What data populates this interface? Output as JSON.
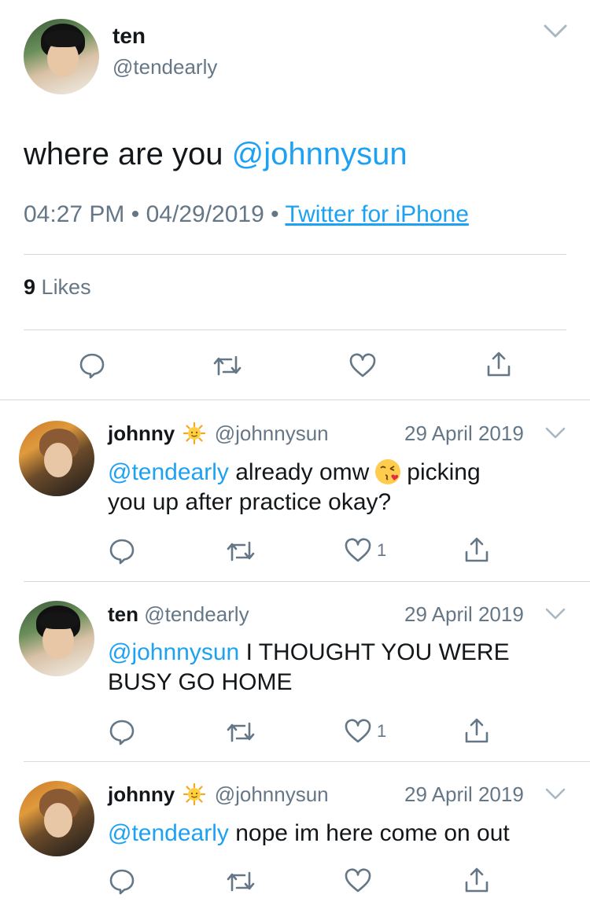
{
  "main_tweet": {
    "name": "ten",
    "handle": "@tendearly",
    "text_plain": "where are you ",
    "text_mention": "@johnnysun",
    "time": "04:27 PM",
    "dot1": "•",
    "date": "04/29/2019",
    "dot2": "•",
    "source": "Twitter for iPhone",
    "likes_count": "9",
    "likes_label": "Likes"
  },
  "replies": [
    {
      "name": "johnny",
      "handle": "@johnnysun",
      "date": "29 April 2019",
      "mention": "@tendearly",
      "text1": " already omw",
      "text2": "picking",
      "text3": "you up after practice okay?",
      "like_count": "1"
    },
    {
      "name": "ten",
      "handle": "@tendearly",
      "date": "29 April 2019",
      "mention": "@johnnysun",
      "text1": " I THOUGHT YOU WERE",
      "text2": "BUSY GO HOME",
      "like_count": "1"
    },
    {
      "name": "johnny",
      "handle": "@johnnysun",
      "date": "29 April 2019",
      "mention": "@tendearly",
      "text1": " nope im here come on out"
    }
  ],
  "icons": [
    "chevron-down-icon",
    "reply-icon",
    "retweet-icon",
    "heart-icon",
    "share-icon",
    "sun-emoji-icon",
    "kiss-emoji-icon"
  ],
  "colors": {
    "link": "#1da1f2",
    "muted": "#657786",
    "text": "#14171a"
  }
}
